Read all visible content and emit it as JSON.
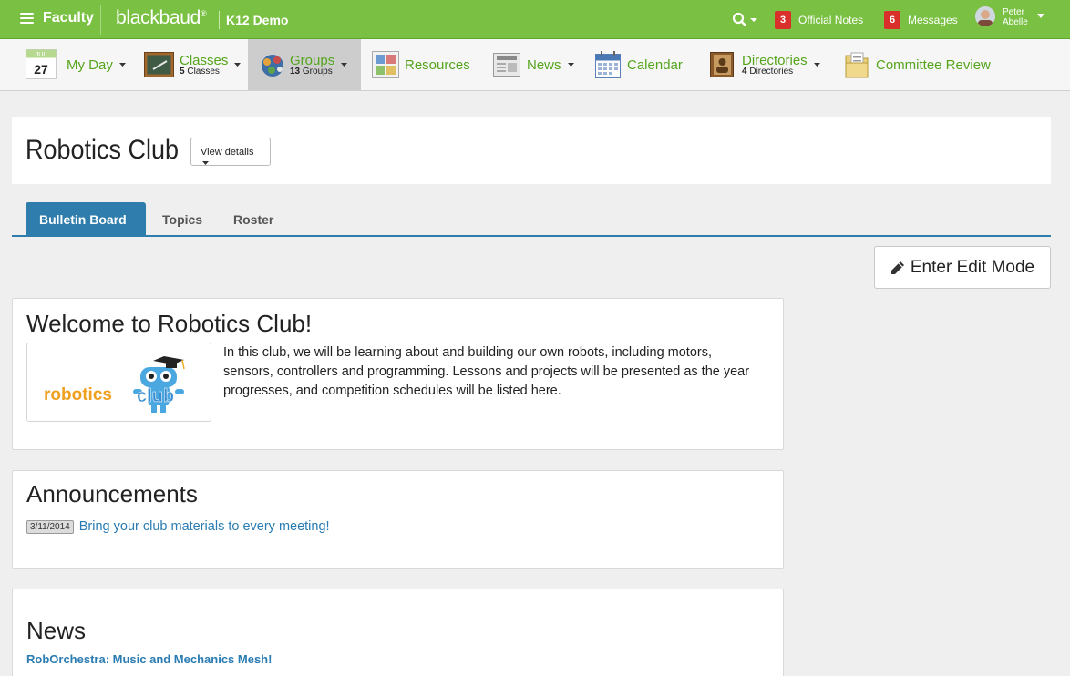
{
  "topbar": {
    "context": "Faculty",
    "brand": "blackbaud",
    "brand_mark": "®",
    "school": "K12 Demo",
    "official_notes": {
      "count": "3",
      "label": "Official Notes"
    },
    "messages": {
      "count": "6",
      "label": "Messages"
    },
    "user": {
      "first": "Peter",
      "last": "Abelle"
    }
  },
  "nav": {
    "myday": {
      "month": "JUL",
      "day": "27",
      "label": "My Day"
    },
    "classes": {
      "label": "Classes",
      "count": "5",
      "sub": "Classes"
    },
    "groups": {
      "label": "Groups",
      "count": "13",
      "sub": "Groups"
    },
    "resources": {
      "label": "Resources"
    },
    "news": {
      "label": "News"
    },
    "calendar": {
      "label": "Calendar"
    },
    "directories": {
      "label": "Directories",
      "count": "4",
      "sub": "Directories"
    },
    "committee": {
      "label": "Committee Review"
    }
  },
  "page": {
    "title": "Robotics Club",
    "view_details": "View details"
  },
  "tabs": [
    {
      "label": "Bulletin Board"
    },
    {
      "label": "Topics"
    },
    {
      "label": "Roster"
    }
  ],
  "edit_button": "Enter Edit Mode",
  "welcome": {
    "title": "Welcome to Robotics Club!",
    "logo_text_a": "robotics",
    "logo_text_b": "club",
    "body": "In this club, we will be learning about and building our own robots, including motors, sensors, controllers and programming. Lessons and projects will be presented as the year progresses, and competition schedules will be listed here."
  },
  "announcements": {
    "title": "Announcements",
    "items": [
      {
        "date": "3/11/2014",
        "text": "Bring your club materials to every meeting!"
      }
    ]
  },
  "news": {
    "title": "News",
    "items": [
      {
        "title": "RobOrchestra: Music and Mechanics Mesh!"
      }
    ]
  },
  "colors": {
    "topbar": "#7ac143",
    "tab_active": "#2e7dac",
    "link": "#2a7cb2",
    "badge": "#d9302c"
  }
}
